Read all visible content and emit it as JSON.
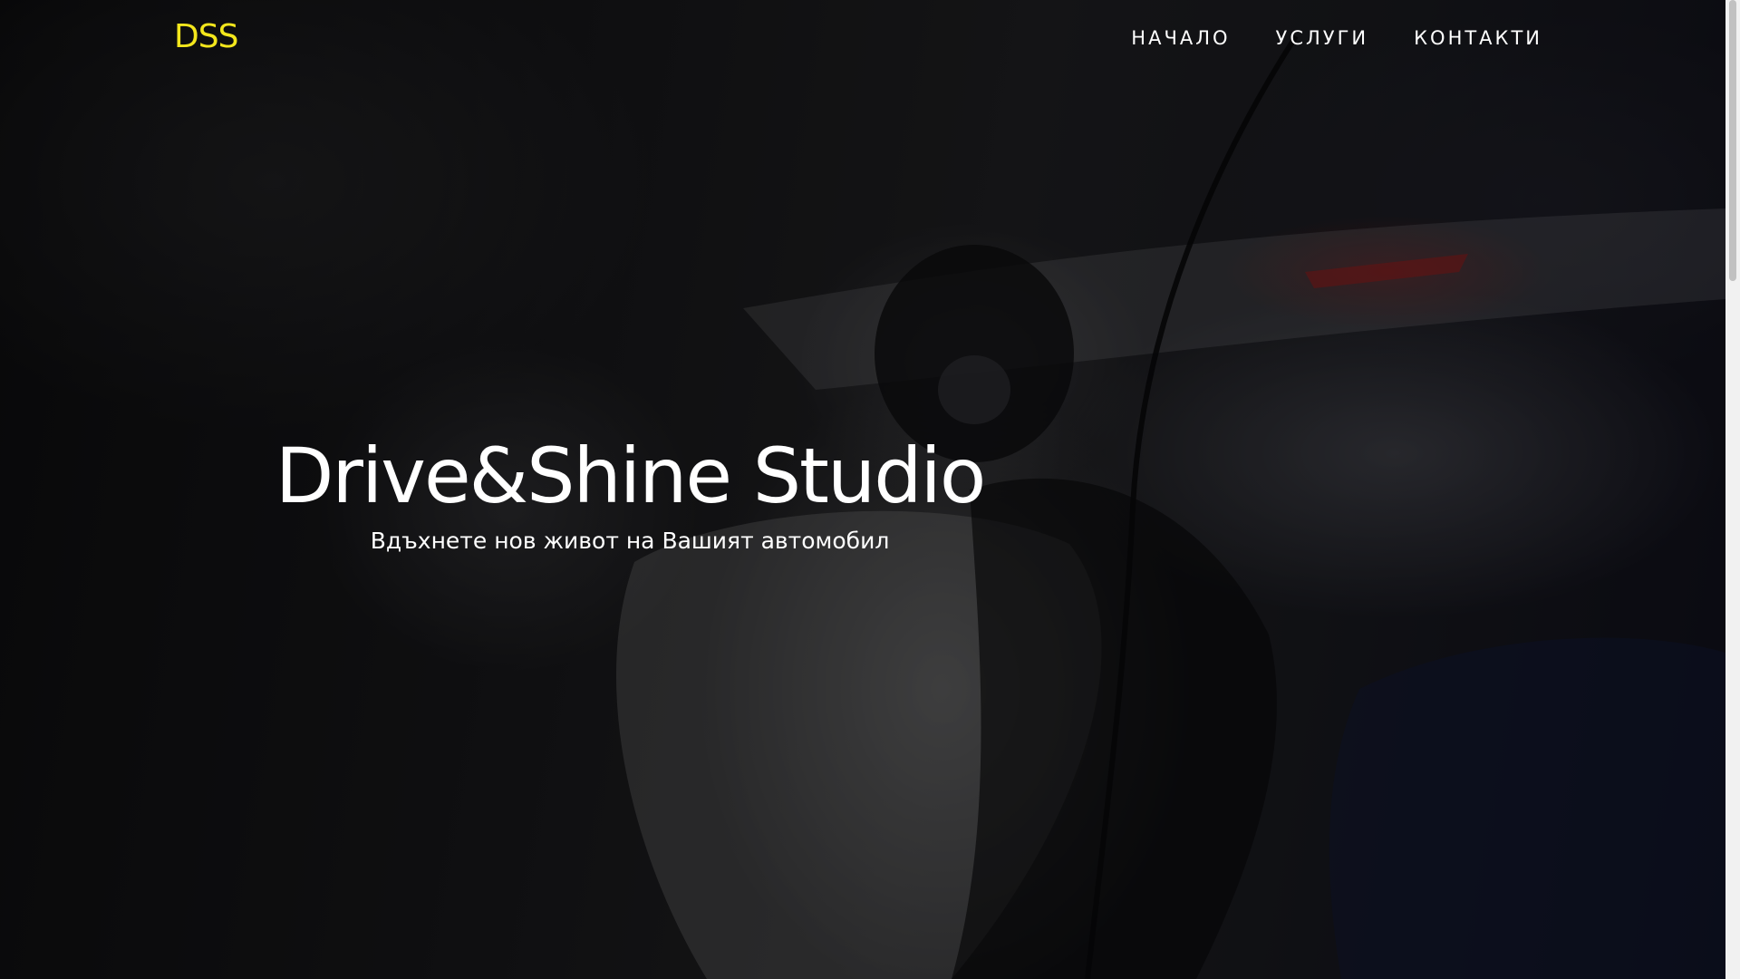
{
  "navbar": {
    "logo": "DSS",
    "links": [
      {
        "label": "НАЧАЛО"
      },
      {
        "label": "УСЛУГИ"
      },
      {
        "label": "КОНТАКТИ"
      }
    ]
  },
  "hero": {
    "title": "Drive&Shine Studio",
    "subtitle": "Вдъхнете нов живот на Вашият автомобил",
    "background_image": "car-detailing-photo"
  },
  "colors": {
    "logo": "#f3e61c",
    "text": "#ffffff",
    "overlay": "#000000"
  }
}
